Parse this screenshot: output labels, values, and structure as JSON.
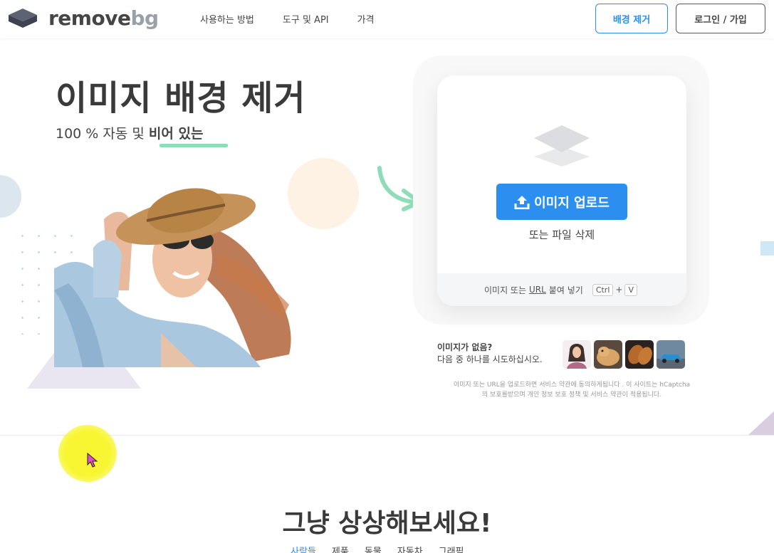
{
  "header": {
    "logo_main": "remove",
    "logo_bg": "bg",
    "nav": [
      "사용하는 방법",
      "도구 및 API",
      "가격"
    ],
    "remove_button": "배경 제거",
    "login_button": "로그인 / 가입"
  },
  "hero": {
    "title": "이미지 배경 제거",
    "subtitle_prefix": "100 % 자동 및 ",
    "subtitle_highlight": "비어 있는"
  },
  "upload": {
    "button_label": "이미지 업로드",
    "drop_text": "또는 파일 삭제",
    "paste_prefix": "이미지 또는",
    "paste_url": "URL",
    "paste_suffix": "붙여 넣기",
    "key_ctrl": "Ctrl",
    "key_plus": "+",
    "key_v": "V"
  },
  "samples": {
    "line1": "이미지가 없음?",
    "line2": "다음 중 하나를 시도하십시오.",
    "thumbnails": [
      "woman-thumbnail",
      "dog-thumbnail",
      "bread-thumbnail",
      "car-thumbnail"
    ]
  },
  "disclaimer": {
    "line1": "이미지 또는 URL을 업로드하면 서비스 약관에 동의하게됩니다 . 이 사이트는 hCaptcha",
    "line2": "의 보호를받으며 개인 정보 보호 정책 및 서비스 약관이 적용됩니다."
  },
  "section": {
    "title": "그냥 상상해보세요!",
    "categories": [
      "사람들",
      "제품",
      "동물",
      "자동차",
      "그래픽"
    ]
  },
  "colors": {
    "accent": "#2c8fef",
    "highlight_underline": "#8fdcb8",
    "text": "#454545"
  }
}
